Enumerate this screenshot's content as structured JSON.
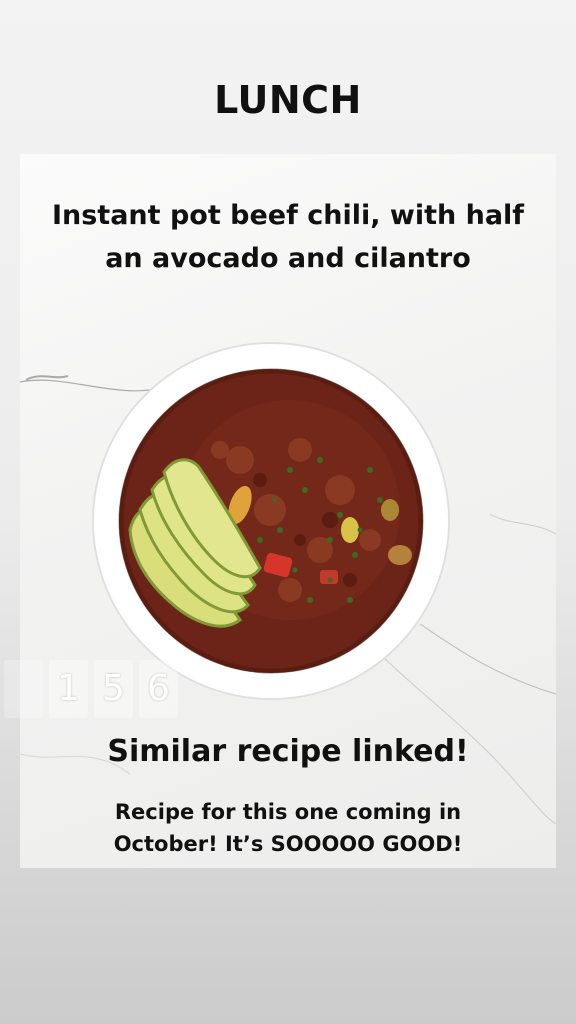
{
  "story": {
    "heading": "LUNCH",
    "card": {
      "title_line1": "Instant pot beef chili, with half",
      "title_line2": "an avocado and cilantro",
      "subtitle": "Similar recipe linked!",
      "note_line1": "Recipe for this one coming in",
      "note_line2": "October! It’s SOOOOO GOOD!"
    },
    "counter": {
      "digits": [
        "",
        "1",
        "5",
        "6"
      ]
    }
  },
  "colors": {
    "text": "#111111",
    "bowl": "#ffffff",
    "chili": "#6b2417",
    "avocado": "#d7dc7a",
    "cilantro": "#3e6b22"
  }
}
